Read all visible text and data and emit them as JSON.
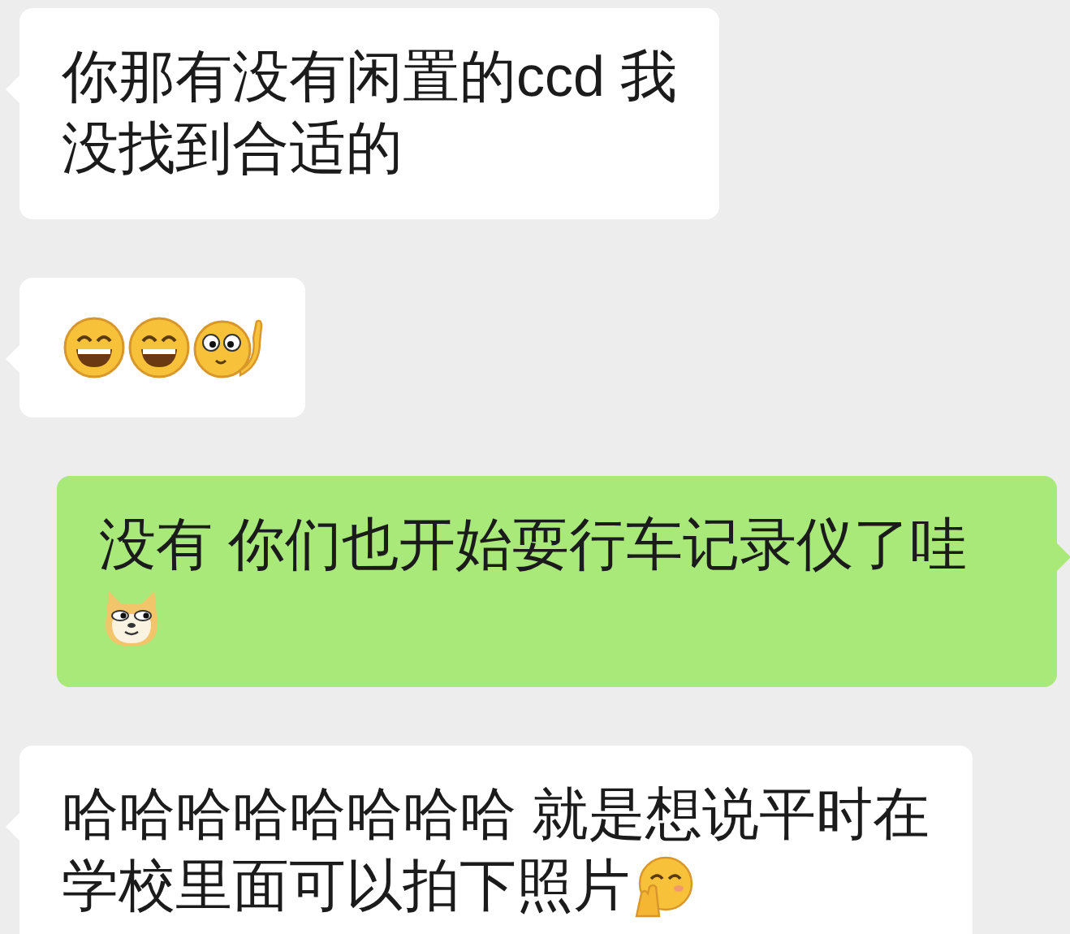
{
  "messages": [
    {
      "kind": "incoming",
      "lines": [
        [
          {
            "kind": "text",
            "text": "你那有没有闲置的ccd 我"
          }
        ],
        [
          {
            "kind": "text",
            "text": "没找到合适的"
          }
        ]
      ]
    },
    {
      "kind": "incoming",
      "lines": [
        [
          {
            "kind": "grin"
          },
          {
            "kind": "grin"
          },
          {
            "kind": "facepalm"
          }
        ]
      ]
    },
    {
      "kind": "outgoing",
      "lines": [
        [
          {
            "kind": "text",
            "text": "没有 你们也开始耍行车记录仪了哇"
          }
        ],
        [
          {
            "kind": "doge"
          }
        ]
      ]
    },
    {
      "kind": "incoming",
      "lines": [
        [
          {
            "kind": "text",
            "text": "哈哈哈哈哈哈哈哈 就是想说平时在"
          }
        ],
        [
          {
            "kind": "text",
            "text": "学校里面可以拍下照片"
          },
          {
            "kind": "shy"
          }
        ]
      ]
    }
  ]
}
